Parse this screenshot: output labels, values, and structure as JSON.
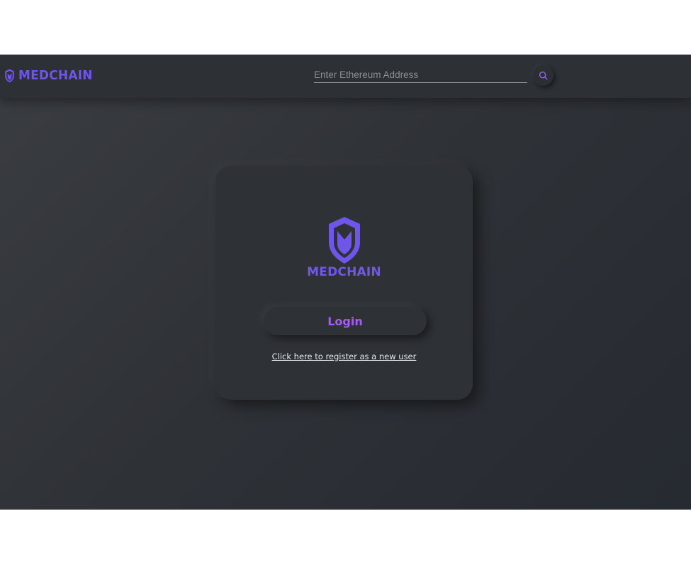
{
  "header": {
    "brand_name": "MEDCHAIN",
    "brand_icon": "shield-m-icon",
    "search": {
      "placeholder": "Enter Ethereum Address",
      "value": "",
      "button_icon": "search-icon"
    }
  },
  "login_card": {
    "logo_icon": "shield-m-icon",
    "logo_text": "MEDCHAIN",
    "login_label": "Login",
    "register_link": "Click here to register as a new user"
  },
  "colors": {
    "brand_purple": "#6f55e8",
    "accent_purple": "#a35ef0",
    "background_dark": "#2e3136"
  }
}
